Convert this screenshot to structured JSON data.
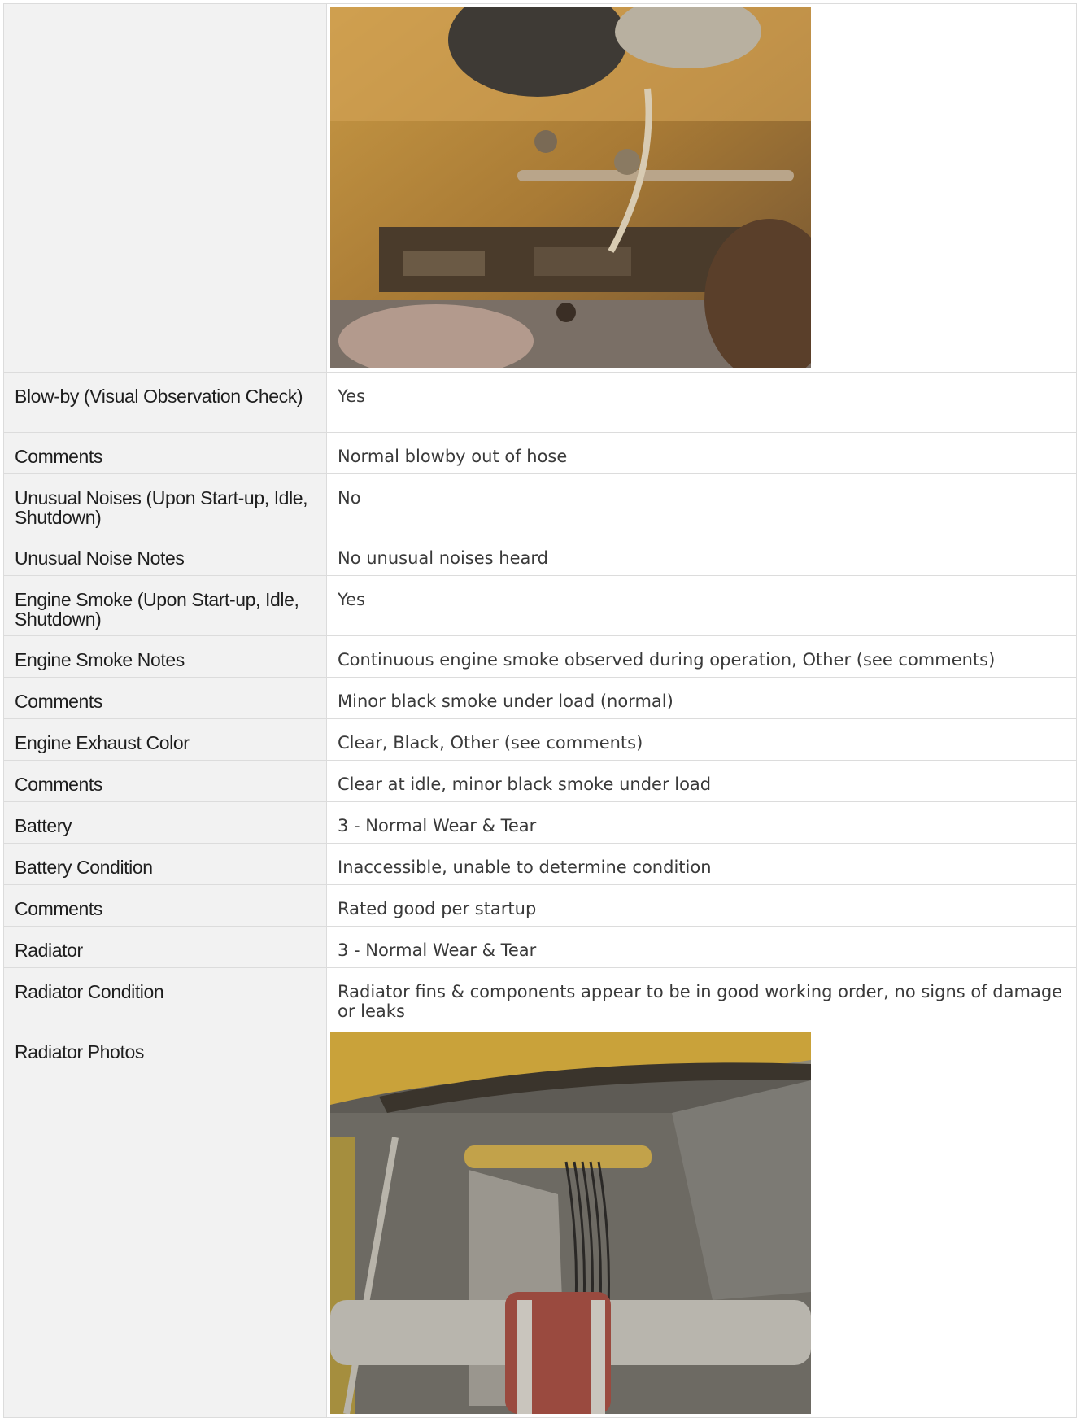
{
  "rows": [
    {
      "label": "",
      "type": "photo",
      "photo_name": "engine-photo"
    },
    {
      "label": "Blow-by (Visual Observation Check)",
      "value": "Yes"
    },
    {
      "label": "Comments",
      "value": "Normal blowby out of hose"
    },
    {
      "label": "Unusual Noises (Upon Start-up, Idle, Shutdown)",
      "value": "No"
    },
    {
      "label": "Unusual Noise Notes",
      "value": "No unusual noises heard"
    },
    {
      "label": "Engine Smoke (Upon Start-up, Idle, Shutdown)",
      "value": "Yes"
    },
    {
      "label": "Engine Smoke Notes",
      "value": "Continuous engine smoke observed during operation, Other (see comments)"
    },
    {
      "label": "Comments",
      "value": "Minor black smoke under load (normal)"
    },
    {
      "label": "Engine Exhaust Color",
      "value": "Clear, Black, Other (see comments)"
    },
    {
      "label": "Comments",
      "value": "Clear at idle, minor black smoke under load"
    },
    {
      "label": "Battery",
      "value": "3 - Normal Wear & Tear"
    },
    {
      "label": "Battery Condition",
      "value": "Inaccessible, unable to determine condition"
    },
    {
      "label": "Comments",
      "value": "Rated good per startup"
    },
    {
      "label": "Radiator",
      "value": "3 - Normal Wear & Tear"
    },
    {
      "label": "Radiator Condition",
      "value": "Radiator fins & components appear to be in good working order, no signs of damage or leaks"
    },
    {
      "label": "Radiator Photos",
      "type": "photo",
      "photo_name": "radiator-photo"
    }
  ],
  "colors": {
    "label_bg": "#f2f2f2",
    "border": "#dcdcdc",
    "label_text": "#1e1e1e",
    "value_text": "#3a3a3a"
  }
}
